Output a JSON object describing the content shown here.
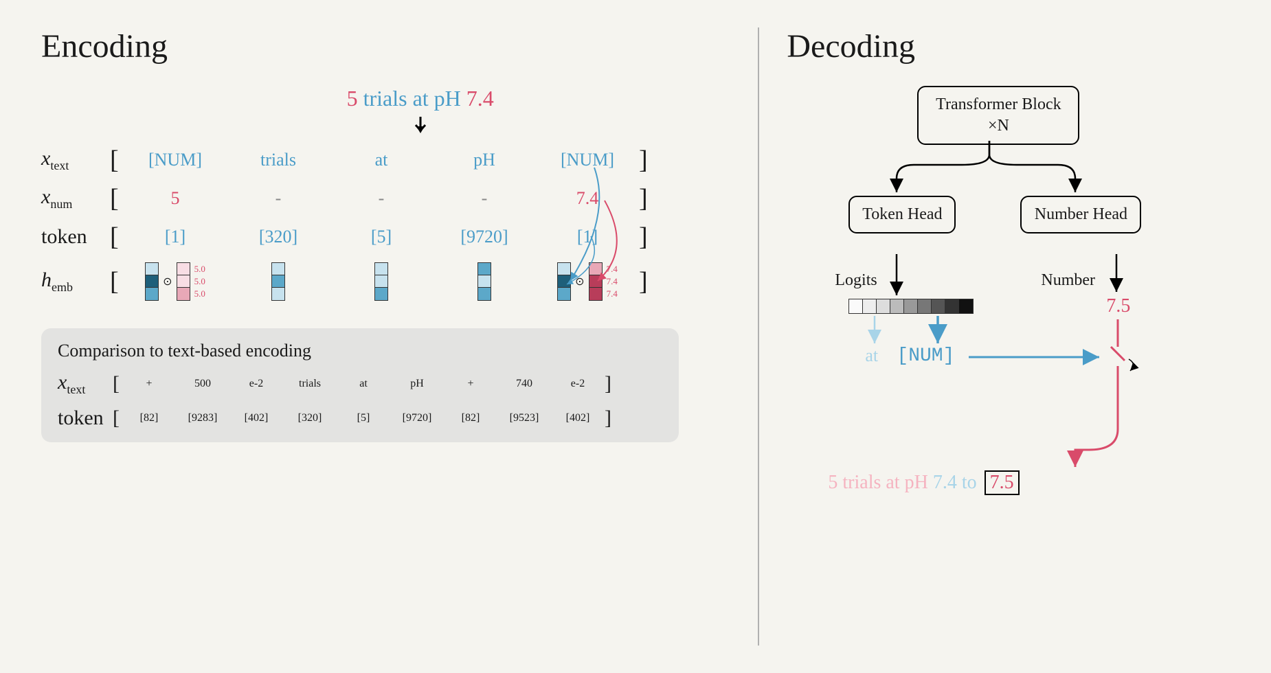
{
  "titles": {
    "encoding": "Encoding",
    "decoding": "Decoding",
    "comparison": "Comparison to text-based encoding"
  },
  "input": {
    "prefix_num": "5",
    "mid_text": " trials at pH ",
    "suffix_num": "7.4"
  },
  "row_labels": {
    "xtext": "x",
    "xtext_sub": "text",
    "xnum": "x",
    "xnum_sub": "num",
    "token": "token",
    "hemb": "h",
    "hemb_sub": "emb"
  },
  "xtext": [
    "[NUM]",
    "trials",
    "at",
    "pH",
    "[NUM]"
  ],
  "xnum": [
    "5",
    "-",
    "-",
    "-",
    "7.4"
  ],
  "tokens": [
    "[1]",
    "[320]",
    "[5]",
    "[9720]",
    "[1]"
  ],
  "emb_labels": {
    "first": "5.0",
    "last": "7.4"
  },
  "comparison": {
    "xtext": [
      "+",
      "500",
      "e-2",
      "trials",
      "at",
      "pH",
      "+",
      "740",
      "e-2"
    ],
    "tokens": [
      "[82]",
      "[9283]",
      "[402]",
      "[320]",
      "[5]",
      "[9720]",
      "[82]",
      "[9523]",
      "[402]"
    ]
  },
  "decoding": {
    "transformer": "Transformer Block ×N",
    "token_head": "Token Head",
    "number_head": "Number Head",
    "logits_label": "Logits",
    "number_label": "Number",
    "number_out": "7.5",
    "at_label": "at",
    "num_token": "[NUM]",
    "output": {
      "part1": "5 trials at pH ",
      "part2": "7.4",
      "part3": " to",
      "boxed": "7.5"
    }
  }
}
